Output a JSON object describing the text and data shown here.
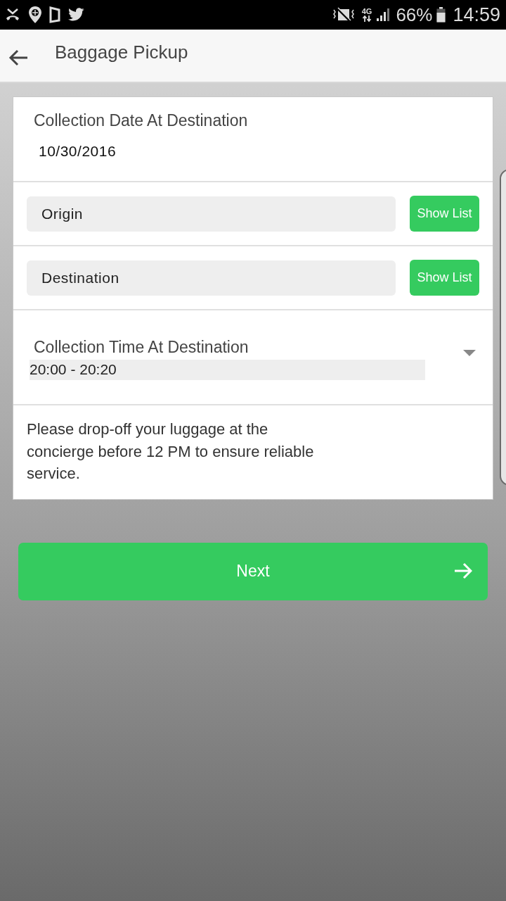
{
  "status_bar": {
    "network": "4G",
    "battery": "66%",
    "time": "14:59"
  },
  "app_bar": {
    "title": "Baggage Pickup"
  },
  "form": {
    "date": {
      "label": "Collection Date At Destination",
      "value": "10/30/2016"
    },
    "locations": [
      {
        "placeholder": "Origin",
        "button": "Show List"
      },
      {
        "placeholder": "Destination",
        "button": "Show List"
      }
    ],
    "time": {
      "label": "Collection Time At Destination",
      "value": "20:00 - 20:20"
    },
    "note": "Please drop-off your luggage at the concierge before 12 PM to ensure reliable service."
  },
  "next_button": {
    "label": "Next"
  }
}
